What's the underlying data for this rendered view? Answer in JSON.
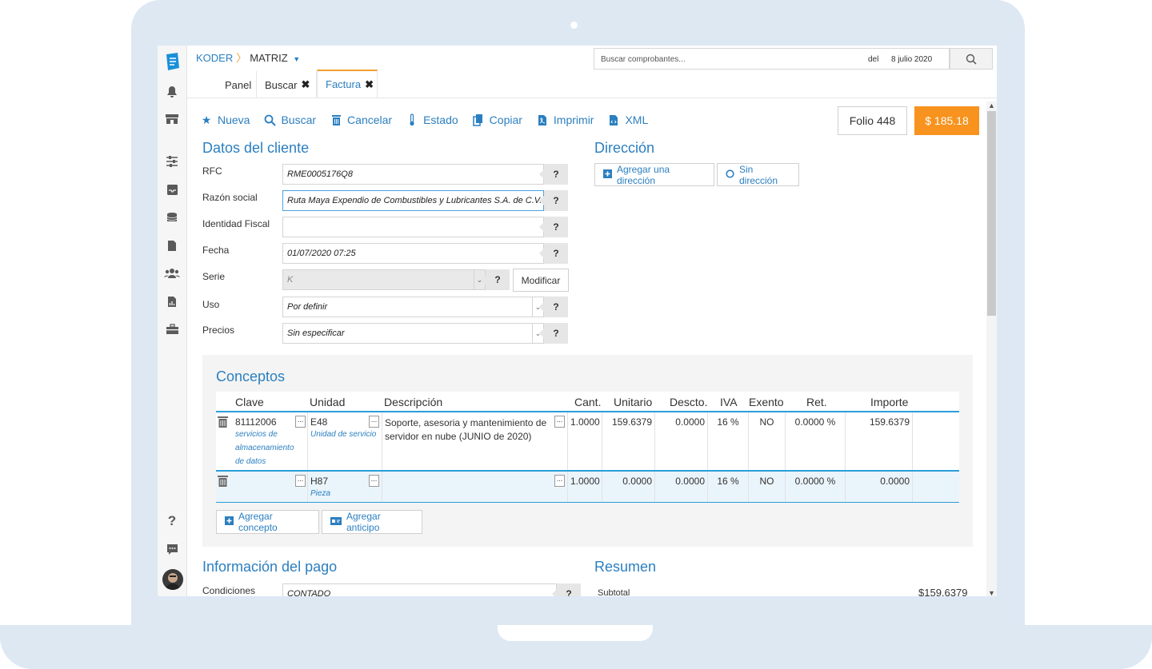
{
  "breadcrumb": {
    "company": "KODER",
    "branch": "MATRIZ"
  },
  "search": {
    "placeholder": "Buscar comprobantes...",
    "del_label": "del",
    "date": "8 julio 2020"
  },
  "tabs": [
    {
      "label": "Panel"
    },
    {
      "label": "Buscar",
      "closable": true
    },
    {
      "label": "Factura",
      "closable": true,
      "active": true
    }
  ],
  "toolbar": {
    "nueva": "Nueva",
    "buscar": "Buscar",
    "cancelar": "Cancelar",
    "estado": "Estado",
    "copiar": "Copiar",
    "imprimir": "Imprimir",
    "xml": "XML"
  },
  "folio": "Folio 448",
  "total": "$ 185.18",
  "cliente": {
    "title": "Datos del cliente",
    "rfc_label": "RFC",
    "rfc": "RME0005176Q8",
    "razon_label": "Razón social",
    "razon": "Ruta Maya Expendio de Combustibles y Lubricantes S.A. de C.V.",
    "identidad_label": "Identidad Fiscal",
    "identidad": "",
    "fecha_label": "Fecha",
    "fecha": "01/07/2020 07:25",
    "serie_label": "Serie",
    "serie": "K",
    "modificar": "Modificar",
    "uso_label": "Uso",
    "uso": "Por definir",
    "precios_label": "Precios",
    "precios": "Sin especificar",
    "help": "?"
  },
  "direccion": {
    "title": "Dirección",
    "agregar": "Agregar una dirección",
    "sin": "Sin dirección"
  },
  "conceptos": {
    "title": "Conceptos",
    "headers": [
      "Clave",
      "Unidad",
      "Descripción",
      "Cant.",
      "Unitario",
      "Descto.",
      "IVA",
      "Exento",
      "Ret.",
      "Importe"
    ],
    "rows": [
      {
        "clave": "81112006",
        "clave_desc": "servicios de almacenamiento de datos",
        "unidad": "E48",
        "unidad_desc": "Unidad de servicio",
        "descripcion": "Soporte, asesoria y mantenimiento de servidor en nube (JUNIO de 2020)",
        "cant": "1.0000",
        "unitario": "159.6379",
        "descto": "0.0000",
        "iva": "16 %",
        "exento": "NO",
        "ret": "0.0000 %",
        "importe": "159.6379"
      },
      {
        "clave": "",
        "clave_desc": "",
        "unidad": "H87",
        "unidad_desc": "Pieza",
        "descripcion": "",
        "cant": "1.0000",
        "unitario": "0.0000",
        "descto": "0.0000",
        "iva": "16 %",
        "exento": "NO",
        "ret": "0.0000 %",
        "importe": "0.0000"
      }
    ],
    "agregar_concepto": "Agregar concepto",
    "agregar_anticipo": "Agregar anticipo",
    "dots": "..."
  },
  "pago": {
    "title": "Información del pago",
    "condiciones_label": "Condiciones",
    "condiciones": "CONTADO"
  },
  "resumen": {
    "title": "Resumen",
    "subtotal_label": "Subtotal",
    "subtotal": "$159.6379"
  },
  "colors": {
    "accent": "#2b7fc0",
    "brand_orange": "#f7931e",
    "table_line": "#2b9ed9"
  }
}
